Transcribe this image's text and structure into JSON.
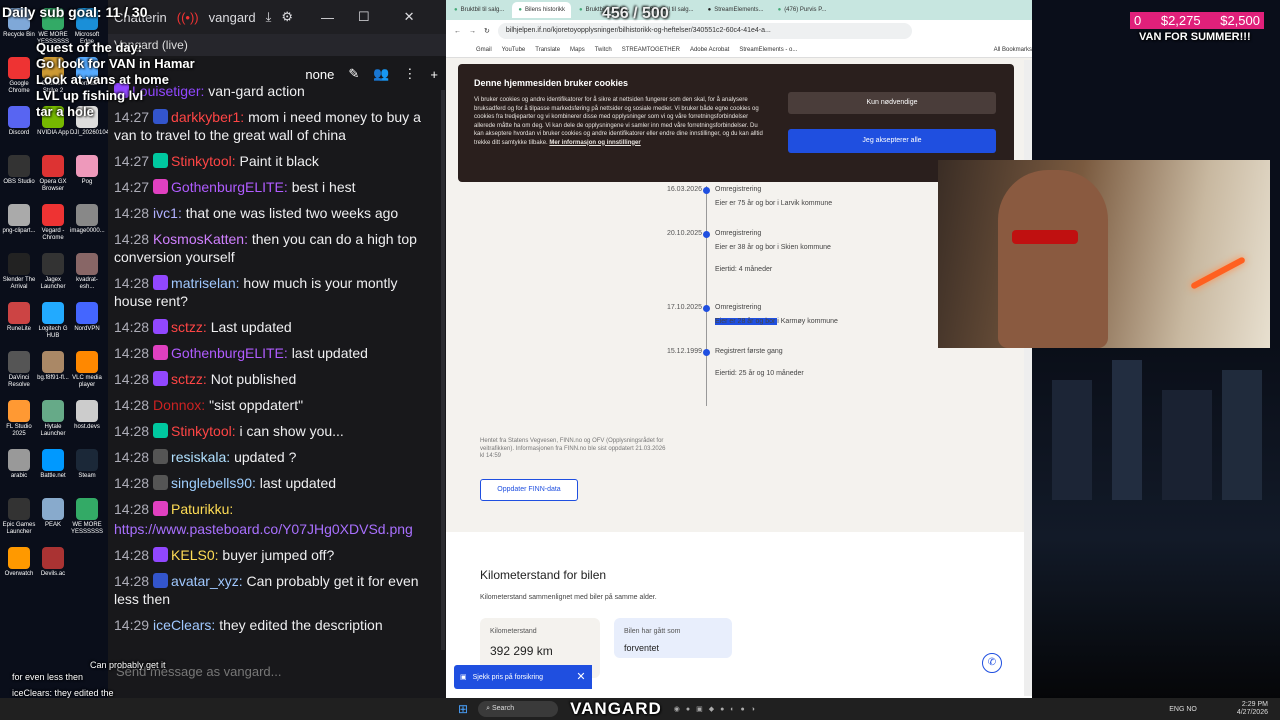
{
  "overlay": {
    "sub_goal": "Daily sub goal: 11 / 30",
    "browser_counter": "456 / 500",
    "donation_count": "0",
    "donation_amount": "$2,275",
    "donation_goal": "$2,500",
    "van_label": "VAN FOR SUMMER!!!",
    "todo": [
      "Quest of the day:",
      "Go look for VAN in Hamar",
      "Look at vans at home",
      "LVL up fishing lvl",
      "tar a hole"
    ],
    "caption_1": "Can probably get it",
    "caption_2": "for even less then",
    "caption_3": "iceClears: they edited the"
  },
  "desktop_icons": [
    {
      "label": "Recycle Bin",
      "color": "#7fa8d8"
    },
    {
      "label": "WE MORE YESSSSSS",
      "color": "#3a6"
    },
    {
      "label": "Microsoft Edge",
      "color": "#1a8fd8"
    },
    {
      "label": "Google Chrome",
      "color": "#e33"
    },
    {
      "label": "Counter-Strike 2",
      "color": "#c93"
    },
    {
      "label": "Fortnite",
      "color": "#5af"
    },
    {
      "label": "Discord",
      "color": "#5865f2"
    },
    {
      "label": "NVIDIA App",
      "color": "#76b900"
    },
    {
      "label": "DJI_20260104",
      "color": "#ddd"
    },
    {
      "label": "OBS Studio",
      "color": "#333"
    },
    {
      "label": "Opera GX Browser",
      "color": "#d33"
    },
    {
      "label": "Pog",
      "color": "#e9b"
    },
    {
      "label": "png-clipart...",
      "color": "#aaa"
    },
    {
      "label": "Vegard - Chrome",
      "color": "#e33"
    },
    {
      "label": "image0000...",
      "color": "#888"
    },
    {
      "label": "Slender The Arrival",
      "color": "#222"
    },
    {
      "label": "Jagex Launcher",
      "color": "#333"
    },
    {
      "label": "kvadrat-esh...",
      "color": "#866"
    },
    {
      "label": "RuneLite",
      "color": "#c44"
    },
    {
      "label": "Logitech G HUB",
      "color": "#2af"
    },
    {
      "label": "NordVPN",
      "color": "#46f"
    },
    {
      "label": "DaVinci Resolve",
      "color": "#555"
    },
    {
      "label": "bg.f8f91-fl...",
      "color": "#a86"
    },
    {
      "label": "VLC media player",
      "color": "#f80"
    },
    {
      "label": "FL Studio 2025",
      "color": "#f93"
    },
    {
      "label": "Hytale Launcher",
      "color": "#6a8"
    },
    {
      "label": "host.devs",
      "color": "#ccc"
    },
    {
      "label": "arabic",
      "color": "#999"
    },
    {
      "label": "Battle.net",
      "color": "#09f"
    },
    {
      "label": "Steam",
      "color": "#1b2838"
    },
    {
      "label": "Epic Games Launcher",
      "color": "#333"
    },
    {
      "label": "PEAK",
      "color": "#8ac"
    },
    {
      "label": "WE MORE YESSSSSS",
      "color": "#3a6"
    },
    {
      "label": "Overwatch",
      "color": "#f90"
    },
    {
      "label": "Devils.ac",
      "color": "#a33"
    }
  ],
  "chat": {
    "tab_title": "Chatterin",
    "user": "vangard",
    "channel_tab": "Vangard (live)",
    "mode": "none",
    "input_placeholder": "Send message as vangard...",
    "messages": [
      {
        "time": "",
        "user": "Louisetiger:",
        "color": "#9147ff",
        "text": "van-gard action",
        "badge": "#9147ff"
      },
      {
        "time": "14:27",
        "user": "darkkyber1:",
        "color": "#ff4545",
        "text": "mom i need money to buy a van to travel to the great wall of china",
        "badge": "#3355cc"
      },
      {
        "time": "14:27",
        "user": "Stinkytool:",
        "color": "#ff4545",
        "text": "Paint it black",
        "badge": "#00c8a0"
      },
      {
        "time": "14:27",
        "user": "GothenburgELITE:",
        "color": "#b05cff",
        "text": "best i hest",
        "badge": "#e040c0"
      },
      {
        "time": "14:28",
        "user": "ivc1:",
        "color": "#b0b0ff",
        "text": "that one was listed two weeks ago",
        "badge": ""
      },
      {
        "time": "14:28",
        "user": "KosmosKatten:",
        "color": "#d080ff",
        "text": "then you can do a high top conversion yourself",
        "badge": ""
      },
      {
        "time": "14:28",
        "user": "matriselan:",
        "color": "#a0c8ff",
        "text": "how much is your montly house rent?",
        "badge": "#9147ff"
      },
      {
        "time": "14:28",
        "user": "sctzz:",
        "color": "#ff4545",
        "text": "Last updated",
        "badge": "#9147ff"
      },
      {
        "time": "14:28",
        "user": "GothenburgELITE:",
        "color": "#b05cff",
        "text": "last updated",
        "badge": "#e040c0"
      },
      {
        "time": "14:28",
        "user": "sctzz:",
        "color": "#ff4545",
        "text": "Not published",
        "badge": "#9147ff"
      },
      {
        "time": "14:28",
        "user": "Donnox:",
        "color": "#cc2222",
        "text": "\"sist oppdatert\"",
        "badge": ""
      },
      {
        "time": "14:28",
        "user": "Stinkytool:",
        "color": "#ff4545",
        "text": "i can show you...",
        "badge": "#00c8a0"
      },
      {
        "time": "14:28",
        "user": "resiskala:",
        "color": "#b0e0ff",
        "text": "updated ?",
        "badge": "#555"
      },
      {
        "time": "14:28",
        "user": "singlebells90:",
        "color": "#a0d0ff",
        "text": "last updated",
        "badge": "#555"
      },
      {
        "time": "14:28",
        "user": "Paturikku:",
        "color": "#ffdd55",
        "text": "",
        "badge": "#e040c0"
      },
      {
        "time": "",
        "user": "",
        "color": "",
        "text": "https://www.pasteboard.co/Y07JHg0XDVSd.png",
        "badge": "",
        "link": true
      },
      {
        "time": "14:28",
        "user": "KELS0:",
        "color": "#ffdd55",
        "text": "buyer jumped off?",
        "badge": "#9147ff"
      },
      {
        "time": "14:28",
        "user": "avatar_xyz:",
        "color": "#a0c8ff",
        "text": "Can probably get it for even less then",
        "badge": "#3355cc"
      },
      {
        "time": "14:29",
        "user": "iceClears:",
        "color": "#a0c8ff",
        "text": "they edited the description",
        "badge": ""
      }
    ]
  },
  "browser": {
    "tabs": [
      "Bruktbil til salg...",
      "Bilens historikk",
      "Bruktbil til salg...",
      "Bruktbil til salg...",
      "StreamElements...",
      "(476) Purvis P..."
    ],
    "url": "bilhjelpen.if.no/kjoretoyopplysninger/bilhistorikk-og-heftelser/340551c2-60c4-41e4-a...",
    "bookmarks": [
      "Gmail",
      "YouTube",
      "Translate",
      "Maps",
      "Twitch",
      "STREAMTOGETHER",
      "Adobe Acrobat",
      "StreamElements - o...",
      "All Bookmarks"
    ],
    "cookie": {
      "title": "Denne hjemmesiden bruker cookies",
      "body": "Vi bruker cookies og andre identifikatorer for å sikre at nettsiden fungerer som den skal, for å analysere bruksadferd og for å tilpasse markedsføring på nettsider og sosiale medier. Vi bruker både egne cookies og cookies fra tredjeparter og vi kombinerer disse med opplysninger som vi og våre forretningsforbindelser allerede måtte ha om deg. Vi kan dele de opplysningene vi samler inn med våre forretningsforbindelser. Du kan akseptere hvordan vi bruker cookies og andre identifikatorer eller endre dine innstillinger, og du kan alltid trekke ditt samtykke tilbake.",
      "link": "Mer informasjon og innstillinger",
      "btn_necessary": "Kun nødvendige",
      "btn_accept": "Jeg aksepterer alle"
    },
    "timeline": [
      {
        "date": "16.03.2026",
        "title": "Omregistrering",
        "detail": "Eier er 75 år og bor i Larvik kommune",
        "extra": ""
      },
      {
        "date": "20.10.2025",
        "title": "Omregistrering",
        "detail": "Eier er 38 år og bor i Skien kommune",
        "extra": "Eiertid: 4 måneder"
      },
      {
        "date": "17.10.2025",
        "title": "Omregistrering",
        "detail": "Eier er 28 år og bor i Karmøy kommune",
        "extra": ""
      },
      {
        "date": "15.12.1999",
        "title": "Registrert første gang",
        "detail": "",
        "extra": "Eiertid: 25 år og 10 måneder"
      }
    ],
    "source": "Hentet fra Statens Vegvesen, FINN.no og OFV (Opplysningsrådet for veitrafikken). Informasjonen fra FINN.no ble sist oppdatert 21.03.2026 kl 14:59",
    "finn_button": "Oppdater FINN-data",
    "km_title": "Kilometerstand for bilen",
    "km_sub": "Kilometerstand sammenlignet med biler på samme alder.",
    "km_label": "Kilometerstand",
    "km_value": "392 299 km",
    "km_card2_label": "Bilen har gått som",
    "km_card2_value": "forventet",
    "insurance_btn": "Sjekk pris på forsikring"
  },
  "taskbar": {
    "search": "Search",
    "streamer": "VANGARD",
    "lang": "ENG NO",
    "time": "2:29 PM",
    "date": "4/27/2026"
  }
}
